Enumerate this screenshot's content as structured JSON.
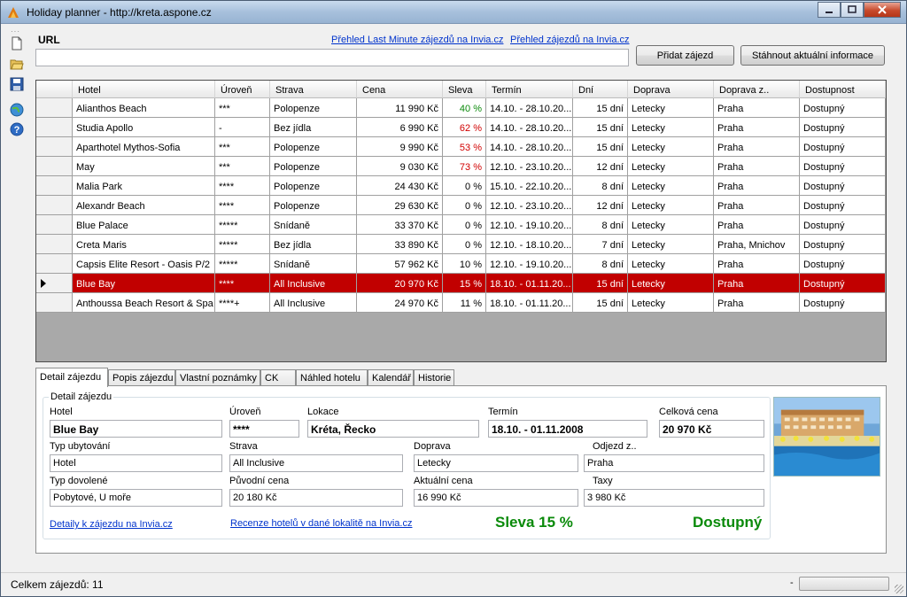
{
  "window": {
    "title": "Holiday planner - http://kreta.aspone.cz",
    "min": "0",
    "max": "1",
    "close": "r"
  },
  "toolbar": {
    "icons": [
      "new-file-icon",
      "open-folder-icon",
      "save-icon",
      "web-icon",
      "help-icon"
    ]
  },
  "url_section": {
    "label": "URL",
    "value": "",
    "link_last_minute": "Přehled Last Minute zájezdů na Invia.cz",
    "link_all": "Přehled zájezdů na Invia.cz",
    "add_button": "Přidat zájezd",
    "download_button": "Stáhnout aktuální informace"
  },
  "grid": {
    "columns": [
      "Hotel",
      "Úroveň",
      "Strava",
      "Cena",
      "Sleva",
      "Termín",
      "Dní",
      "Doprava",
      "Doprava z..",
      "Dostupnost"
    ],
    "selected_index": 9,
    "rows": [
      {
        "hotel": "Alianthos Beach",
        "level": "***",
        "board": "Polopenze",
        "price": "11 990 Kč",
        "discount": "40 %",
        "disc_color": "green",
        "term": "14.10. - 28.10.20...",
        "days": "15 dní",
        "transport": "Letecky",
        "from": "Praha",
        "avail": "Dostupný"
      },
      {
        "hotel": "Studia Apollo",
        "level": "-",
        "board": "Bez jídla",
        "price": "6 990 Kč",
        "discount": "62 %",
        "disc_color": "red",
        "term": "14.10. - 28.10.20...",
        "days": "15 dní",
        "transport": "Letecky",
        "from": "Praha",
        "avail": "Dostupný"
      },
      {
        "hotel": "Aparthotel Mythos-Sofia",
        "level": "***",
        "board": "Polopenze",
        "price": "9 990 Kč",
        "discount": "53 %",
        "disc_color": "red",
        "term": "14.10. - 28.10.20...",
        "days": "15 dní",
        "transport": "Letecky",
        "from": "Praha",
        "avail": "Dostupný"
      },
      {
        "hotel": "May",
        "level": "***",
        "board": "Polopenze",
        "price": "9 030 Kč",
        "discount": "73 %",
        "disc_color": "red",
        "term": "12.10. - 23.10.20...",
        "days": "12 dní",
        "transport": "Letecky",
        "from": "Praha",
        "avail": "Dostupný"
      },
      {
        "hotel": "Malia Park",
        "level": "****",
        "board": "Polopenze",
        "price": "24 430 Kč",
        "discount": "0 %",
        "disc_color": "black",
        "term": "15.10. - 22.10.20...",
        "days": "8 dní",
        "transport": "Letecky",
        "from": "Praha",
        "avail": "Dostupný"
      },
      {
        "hotel": "Alexandr Beach",
        "level": "****",
        "board": "Polopenze",
        "price": "29 630 Kč",
        "discount": "0 %",
        "disc_color": "black",
        "term": "12.10. - 23.10.20...",
        "days": "12 dní",
        "transport": "Letecky",
        "from": "Praha",
        "avail": "Dostupný"
      },
      {
        "hotel": "Blue Palace",
        "level": "*****",
        "board": "Snídaně",
        "price": "33 370 Kč",
        "discount": "0 %",
        "disc_color": "black",
        "term": "12.10. - 19.10.20...",
        "days": "8 dní",
        "transport": "Letecky",
        "from": "Praha",
        "avail": "Dostupný"
      },
      {
        "hotel": "Creta Maris",
        "level": "*****",
        "board": "Bez jídla",
        "price": "33 890 Kč",
        "discount": "0 %",
        "disc_color": "black",
        "term": "12.10. - 18.10.20...",
        "days": "7 dní",
        "transport": "Letecky",
        "from": "Praha, Mnichov",
        "avail": "Dostupný"
      },
      {
        "hotel": "Capsis Elite Resort - Oasis P/2",
        "level": "*****",
        "board": "Snídaně",
        "price": "57 962 Kč",
        "discount": "10 %",
        "disc_color": "black",
        "term": "12.10. - 19.10.20...",
        "days": "8 dní",
        "transport": "Letecky",
        "from": "Praha",
        "avail": "Dostupný"
      },
      {
        "hotel": "Blue Bay",
        "level": "****",
        "board": "All Inclusive",
        "price": "20 970 Kč",
        "discount": "15 %",
        "disc_color": "black",
        "term": "18.10. - 01.11.20...",
        "days": "15 dní",
        "transport": "Letecky",
        "from": "Praha",
        "avail": "Dostupný"
      },
      {
        "hotel": "Anthoussa Beach Resort & Spa",
        "level": "****+",
        "board": "All Inclusive",
        "price": "24 970 Kč",
        "discount": "11 %",
        "disc_color": "black",
        "term": "18.10. - 01.11.20...",
        "days": "15 dní",
        "transport": "Letecky",
        "from": "Praha",
        "avail": "Dostupný"
      }
    ]
  },
  "tabs": [
    "Detail zájezdu",
    "Popis zájezdu",
    "Vlastní poznámky",
    "CK",
    "Náhled hotelu",
    "Kalendář",
    "Historie"
  ],
  "detail": {
    "group_title": "Detail zájezdu",
    "hotel_label": "Hotel",
    "hotel": "Blue Bay",
    "level_label": "Úroveň",
    "level": "****",
    "location_label": "Lokace",
    "location": "Kréta, Řecko",
    "term_label": "Termín",
    "term": "18.10. - 01.11.2008",
    "total_label": "Celková cena",
    "total": "20 970 Kč",
    "accom_label": "Typ ubytování",
    "accom": "Hotel",
    "board_label": "Strava",
    "board": "All Inclusive",
    "transport_label": "Doprava",
    "transport": "Letecky",
    "depart_label": "Odjezd z..",
    "depart": "Praha",
    "holiday_type_label": "Typ dovolené",
    "holiday_type": "Pobytové, U moře",
    "orig_price_label": "Původní cena",
    "orig_price": "20 180 Kč",
    "cur_price_label": "Aktuální cena",
    "cur_price": "16 990 Kč",
    "tax_label": "Taxy",
    "tax": "3 980 Kč",
    "link_detail": "Detaily k zájezdu na Invia.cz",
    "link_reviews": "Recenze hotelů v dané lokalitě na Invia.cz",
    "discount_text": "Sleva 15 %",
    "availability_text": "Dostupný"
  },
  "status": {
    "count": "Celkem zájezdů: 11",
    "dash": "-"
  },
  "colors": {
    "selected_row": "#c10000",
    "discount_good": "#0b8a0b",
    "discount_bad": "#d10000",
    "link": "#0033cc"
  }
}
